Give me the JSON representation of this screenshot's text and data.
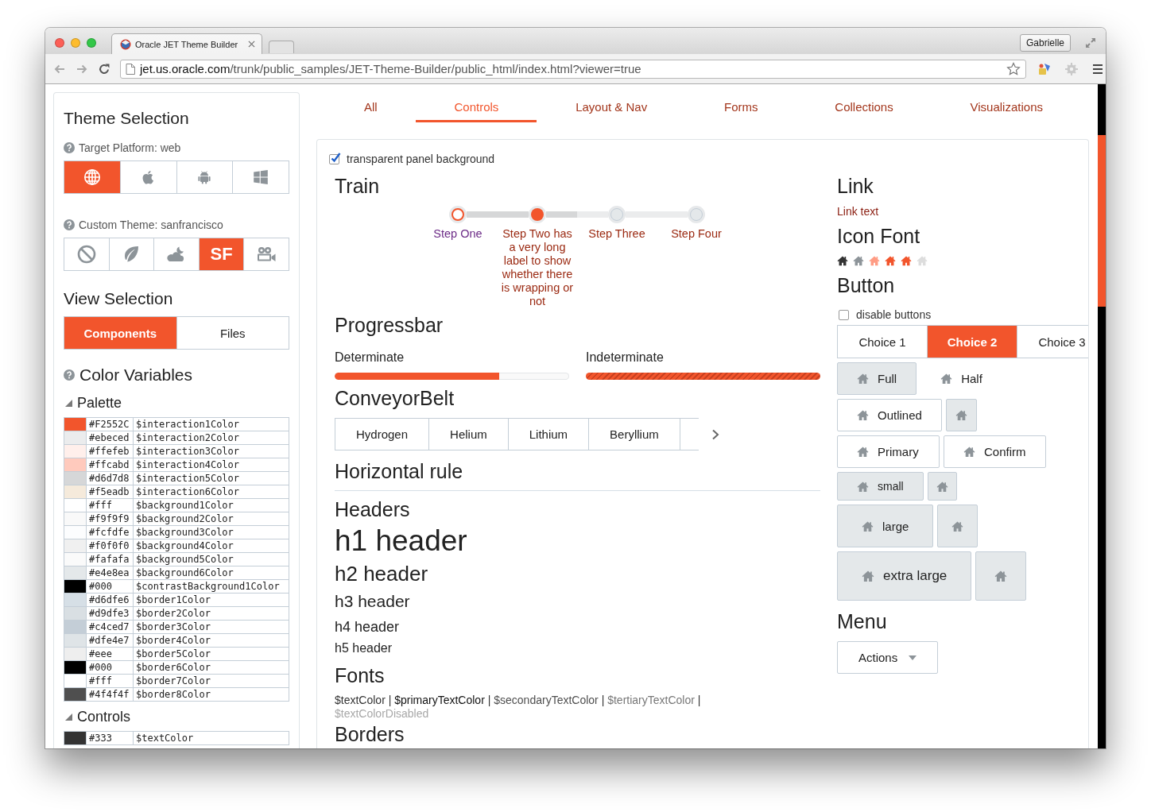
{
  "browser": {
    "tab_title": "Oracle JET Theme Builder",
    "user_button": "Gabrielle",
    "url_host": "jet.us.oracle.com",
    "url_path": "/trunk/public_samples/JET-Theme-Builder/public_html/index.html?viewer=true"
  },
  "sidebar": {
    "title": "Theme Selection",
    "platform_label": "Target Platform: web",
    "platforms": [
      {
        "kind": "web",
        "selected": true
      },
      {
        "kind": "ios",
        "selected": false
      },
      {
        "kind": "android",
        "selected": false
      },
      {
        "kind": "windows",
        "selected": false
      }
    ],
    "theme_label": "Custom Theme: sanfrancisco",
    "themes": [
      {
        "kind": "none",
        "selected": false
      },
      {
        "kind": "leaf",
        "selected": false
      },
      {
        "kind": "night",
        "selected": false
      },
      {
        "kind": "text",
        "label": "SF",
        "selected": true
      },
      {
        "kind": "camera",
        "selected": false
      }
    ],
    "view_title": "View Selection",
    "views": [
      {
        "label": "Components",
        "selected": true
      },
      {
        "label": "Files",
        "selected": false
      }
    ],
    "colors_title": "Color Variables",
    "groups": [
      {
        "title": "Palette",
        "expanded": true,
        "rows": [
          {
            "color": "#f2552c",
            "hex": "#F2552C",
            "name": "$interaction1Color"
          },
          {
            "color": "#ebeced",
            "hex": "#ebeced",
            "name": "$interaction2Color"
          },
          {
            "color": "#ffefeb",
            "hex": "#ffefeb",
            "name": "$interaction3Color"
          },
          {
            "color": "#ffcabd",
            "hex": "#ffcabd",
            "name": "$interaction4Color"
          },
          {
            "color": "#d6d7d8",
            "hex": "#d6d7d8",
            "name": "$interaction5Color"
          },
          {
            "color": "#f5eadb",
            "hex": "#f5eadb",
            "name": "$interaction6Color"
          },
          {
            "color": "#ffffff",
            "hex": "#fff",
            "name": "$background1Color"
          },
          {
            "color": "#f9f9f9",
            "hex": "#f9f9f9",
            "name": "$background2Color"
          },
          {
            "color": "#fcfdfe",
            "hex": "#fcfdfe",
            "name": "$background3Color"
          },
          {
            "color": "#f0f0f0",
            "hex": "#f0f0f0",
            "name": "$background4Color"
          },
          {
            "color": "#fafafa",
            "hex": "#fafafa",
            "name": "$background5Color"
          },
          {
            "color": "#e4e8ea",
            "hex": "#e4e8ea",
            "name": "$background6Color"
          },
          {
            "color": "#000000",
            "hex": "#000",
            "name": "$contrastBackground1Color"
          },
          {
            "color": "#d6dfe6",
            "hex": "#d6dfe6",
            "name": "$border1Color"
          },
          {
            "color": "#d9dfe3",
            "hex": "#d9dfe3",
            "name": "$border2Color"
          },
          {
            "color": "#c4ced7",
            "hex": "#c4ced7",
            "name": "$border3Color"
          },
          {
            "color": "#dfe4e7",
            "hex": "#dfe4e7",
            "name": "$border4Color"
          },
          {
            "color": "#eeeeee",
            "hex": "#eee",
            "name": "$border5Color"
          },
          {
            "color": "#000000",
            "hex": "#000",
            "name": "$border6Color"
          },
          {
            "color": "#ffffff",
            "hex": "#fff",
            "name": "$border7Color"
          },
          {
            "color": "#4f4f4f",
            "hex": "#4f4f4f",
            "name": "$border8Color"
          }
        ]
      },
      {
        "title": "Controls",
        "expanded": true,
        "rows": [
          {
            "color": "#333333",
            "hex": "#333",
            "name": "$textColor"
          }
        ]
      }
    ]
  },
  "nav_tabs": [
    {
      "label": "All",
      "selected": false
    },
    {
      "label": "Controls",
      "selected": true
    },
    {
      "label": "Layout & Nav",
      "selected": false
    },
    {
      "label": "Forms",
      "selected": false
    },
    {
      "label": "Collections",
      "selected": false
    },
    {
      "label": "Visualizations",
      "selected": false
    }
  ],
  "panel": {
    "transparent_checkbox": {
      "label": "transparent panel background",
      "checked": true
    },
    "train": {
      "title": "Train",
      "steps": [
        {
          "label": "Step One",
          "visited": true,
          "selected": false
        },
        {
          "label": "Step Two has a very long label to show whether there is wrapping or not",
          "visited": false,
          "selected": true
        },
        {
          "label": "Step Three",
          "visited": false,
          "selected": false
        },
        {
          "label": "Step Four",
          "visited": false,
          "selected": false
        }
      ]
    },
    "progressbar": {
      "title": "Progressbar",
      "bars": [
        {
          "kind": "determinate",
          "label": "Determinate",
          "level": 0.7
        },
        {
          "kind": "indeterminate",
          "label": "Indeterminate"
        }
      ]
    },
    "conveyor": {
      "title": "ConveyorBelt",
      "items": [
        "Hydrogen",
        "Helium",
        "Lithium",
        "Beryllium"
      ]
    },
    "hr_title": "Horizontal rule",
    "headers": {
      "title": "Headers",
      "items": [
        "h1 header",
        "h2 header",
        "h3 header",
        "h4 header",
        "h5 header"
      ]
    },
    "fonts": {
      "title": "Fonts",
      "samples": [
        {
          "kind": "text",
          "text": "$textColor"
        },
        {
          "kind": "separator",
          "text": "|"
        },
        {
          "kind": "primary",
          "text": "$primaryTextColor"
        },
        {
          "kind": "separator",
          "text": "|"
        },
        {
          "kind": "secondary",
          "text": "$secondaryTextColor"
        },
        {
          "kind": "separator",
          "text": "|"
        },
        {
          "kind": "tertiary",
          "text": "$tertiaryTextColor"
        },
        {
          "kind": "separator",
          "text": "|"
        },
        {
          "kind": "disabled",
          "text": "$textColorDisabled"
        }
      ]
    },
    "borders_title": "Borders",
    "link": {
      "title": "Link",
      "text": "Link text"
    },
    "icon_font": {
      "title": "Icon Font",
      "icons": [
        {
          "color": "#333333"
        },
        {
          "color": "#8d9499"
        },
        {
          "color": "#ff9c84"
        },
        {
          "color": "#f2552c"
        },
        {
          "color": "#f2552c"
        },
        {
          "color": "#dddddd"
        }
      ]
    },
    "button": {
      "title": "Button",
      "disable_checkbox": {
        "label": "disable buttons",
        "checked": false
      },
      "buttonset": [
        {
          "label": "Choice 1",
          "selected": false
        },
        {
          "label": "Choice 2",
          "selected": true
        },
        {
          "label": "Choice 3",
          "selected": false
        }
      ],
      "rows": [
        {
          "kind": "normal",
          "buttons": [
            {
              "kind": "full",
              "label": "Full"
            },
            {
              "kind": "half",
              "label": "Half"
            }
          ]
        },
        {
          "kind": "normal",
          "buttons": [
            {
              "kind": "outlined",
              "label": "Outlined"
            },
            {
              "kind": "full"
            }
          ]
        },
        {
          "kind": "normal",
          "buttons": [
            {
              "kind": "outlined",
              "label": "Primary"
            },
            {
              "kind": "outlined",
              "label": "Confirm"
            }
          ]
        },
        {
          "kind": "small",
          "buttons": [
            {
              "kind": "full",
              "label": "small"
            },
            {
              "kind": "full"
            }
          ]
        },
        {
          "kind": "large",
          "buttons": [
            {
              "kind": "full",
              "label": "large"
            },
            {
              "kind": "full"
            }
          ]
        },
        {
          "kind": "xlarge",
          "buttons": [
            {
              "kind": "full",
              "label": "extra large"
            },
            {
              "kind": "full"
            }
          ]
        }
      ]
    },
    "menu": {
      "title": "Menu",
      "button": "Actions"
    }
  }
}
